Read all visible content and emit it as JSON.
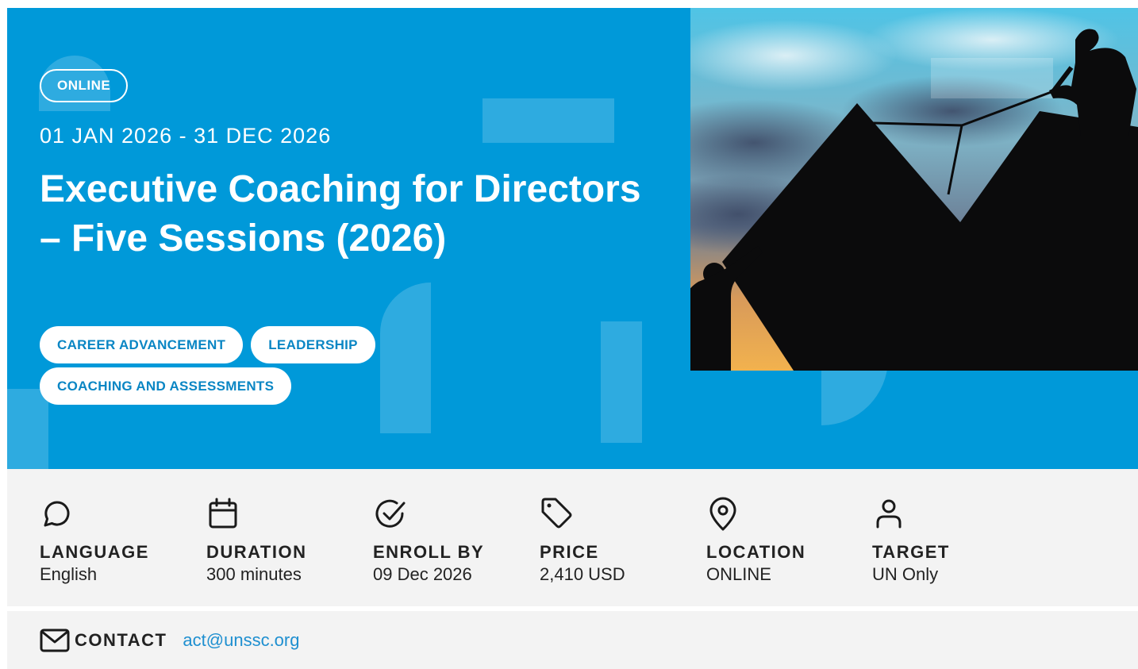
{
  "hero": {
    "badge": "ONLINE",
    "dates": "01 JAN 2026 - 31 DEC 2026",
    "title": "Executive Coaching for Directors – Five Sessions (2026)",
    "tags": [
      "CAREER ADVANCEMENT",
      "LEADERSHIP",
      "COACHING AND ASSESSMENTS"
    ],
    "background_color": "#0099d9"
  },
  "details": [
    {
      "icon": "chat-bubble-icon",
      "label": "LANGUAGE",
      "value": "English"
    },
    {
      "icon": "calendar-icon",
      "label": "DURATION",
      "value": "300 minutes"
    },
    {
      "icon": "check-circle-icon",
      "label": "ENROLL BY",
      "value": "09 Dec 2026"
    },
    {
      "icon": "price-tag-icon",
      "label": "PRICE",
      "value": "2,410 USD"
    },
    {
      "icon": "location-pin-icon",
      "label": "LOCATION",
      "value": "ONLINE"
    },
    {
      "icon": "user-icon",
      "label": "TARGET",
      "value": "UN Only"
    }
  ],
  "contact": {
    "icon": "mail-icon",
    "label": "CONTACT",
    "email": "act@unssc.org",
    "link_color": "#1e8fd0"
  }
}
